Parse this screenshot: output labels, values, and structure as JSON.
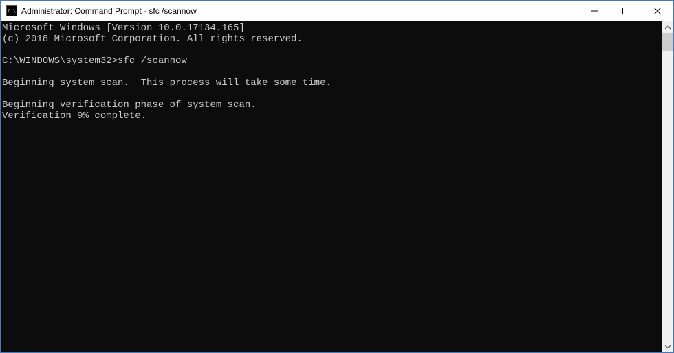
{
  "window": {
    "title": "Administrator: Command Prompt - sfc  /scannow",
    "icon_label": "C:\\"
  },
  "terminal": {
    "lines": [
      "Microsoft Windows [Version 10.0.17134.165]",
      "(c) 2018 Microsoft Corporation. All rights reserved.",
      "",
      "C:\\WINDOWS\\system32>sfc /scannow",
      "",
      "Beginning system scan.  This process will take some time.",
      "",
      "Beginning verification phase of system scan.",
      "Verification 9% complete."
    ]
  }
}
